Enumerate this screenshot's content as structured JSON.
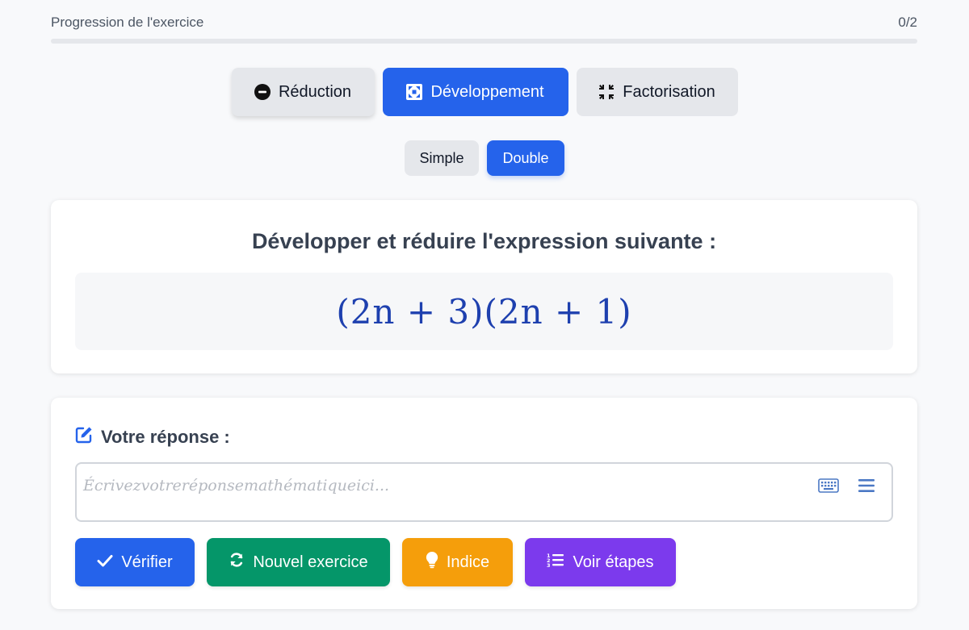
{
  "progress": {
    "label": "Progression de l'exercice",
    "count": "0/2",
    "value": 0
  },
  "modes": [
    {
      "label": "Réduction",
      "icon": "minus-circle-icon"
    },
    {
      "label": "Développement",
      "icon": "expand-icon",
      "active": true
    },
    {
      "label": "Factorisation",
      "icon": "compress-icon"
    }
  ],
  "subModes": [
    {
      "label": "Simple"
    },
    {
      "label": "Double",
      "active": true
    }
  ],
  "question": {
    "title": "Développer et réduire l'expression suivante :",
    "expression": "(2n + 3)(2n + 1)"
  },
  "answer": {
    "label": "Votre réponse :",
    "placeholder": "Écrivezvotreréponsemathématiqueici...",
    "keyboard_icon": "keyboard-icon",
    "menu_icon": "menu-icon"
  },
  "actions": {
    "verify": "Vérifier",
    "new": "Nouvel exercice",
    "hint": "Indice",
    "steps": "Voir étapes"
  },
  "colors": {
    "primary": "#2563eb",
    "success": "#059669",
    "warning": "#f59e0b",
    "purple": "#7c3aed",
    "expression": "#1e40af"
  }
}
